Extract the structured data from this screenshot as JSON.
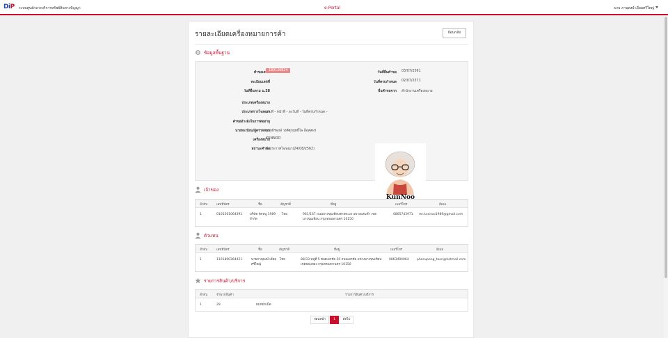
{
  "header": {
    "logo_main": "Di",
    "logo_accent": "P",
    "org_name": "ระบบศูนย์กลางบริการทรัพย์สินทางปัญญา",
    "portal_name": "e-Portal",
    "user_name": "นาย ภานุพงษ์ เอี่ยมศรีใหญ่"
  },
  "page": {
    "title": "รายละเอียดเครื่องหมายการค้า",
    "back_label": "ย้อนกลับ"
  },
  "basic_info": {
    "section_title": "ข้อมูลพื้นฐาน",
    "left_fields": [
      {
        "label": "คำขอเลขที่",
        "value": "180120824"
      },
      {
        "label": "ทะเบียนเลขที่",
        "value": "-"
      },
      {
        "label": "วันที่ยื่นตาม ม.28",
        "value": "-"
      },
      {
        "label": "ประเภทเครื่องหมาย",
        "value": "-"
      },
      {
        "label": "ประเภทการโฆษณา",
        "value": "เล่มที่ - หน้าที่ - ลงวันที่ - วันที่ครบกำหนด -"
      },
      {
        "label": "คำขออ้างอิงในการต่ออายุ",
        "value": "-"
      },
      {
        "label": "นายทะเบียน/ผู้ตรวจสอบ",
        "value": "นายธีรพงษ์ วงศ์ศุภฤทธิ์ไพ อ็อสสพร"
      },
      {
        "label": "เครื่องหมาย",
        "value": "KUNNOO"
      },
      {
        "label": "สถานะคำขอ",
        "value": "สั่งประกาศโฆษณา(24/08/2562)"
      }
    ],
    "right_fields": [
      {
        "label": "วันที่ยื่นคำขอ",
        "value": "03/07/2561"
      },
      {
        "label": "วันที่ครบกำหนด",
        "value": "02/07/2571"
      },
      {
        "label": "ยื่นคำขอจาก",
        "value": "สำนักงานเครื่องหมาย"
      }
    ],
    "mark_text": "KunNoo",
    "colors": {
      "badge": "#e98a8a",
      "accent": "#c8102e"
    }
  },
  "owner": {
    "section_title": "เจ้าของ",
    "headers": [
      "ลำดับ",
      "เลขที่บัตร",
      "ชื่อ",
      "สัญชาติ",
      "ที่อยู่",
      "เบอร์โทร",
      "อีเมล"
    ],
    "rows": [
      [
        "1",
        "0105561064391",
        "บริษัท จัดหนู 1989 จำกัด",
        "ไทย",
        "961/167 ถนนบางขุนเทียนชายทะเล แขวงแสมดำ เขตบางขุนเทียน กรุงเทพมหานคร 10150",
        "0865743971",
        "mr.kunnoo1989@gmail.com"
      ]
    ]
  },
  "agent": {
    "section_title": "ตัวแทน",
    "headers": [
      "ลำดับ",
      "เลขที่บัตร",
      "ชื่อ",
      "สัญชาติ",
      "ที่อยู่",
      "เบอร์โทร",
      "อีเมล"
    ],
    "rows": [
      [
        "1",
        "1101800364421",
        "นายภานุพงษ์ เอี่ยมศรีใหญ่",
        "ไทย",
        "88/33 หมู่ที่ 5 ซอยเอกชัย 30 ถนนเอกชัย แขวงบางขุนเทียน เขตจอมทอง กรุงเทพมหานคร 10150",
        "0863494064",
        "phanupong_toon@hotmail.com"
      ]
    ]
  },
  "services": {
    "section_title": "รายการสินค้า/บริการ",
    "headers": [
      "ลำดับ",
      "จำพวกสินค้า",
      "รายการสินค้า/บริการ"
    ],
    "rows": [
      [
        "1",
        "29",
        "ผมหมักเม็ด"
      ]
    ]
  },
  "pagination": {
    "prev": "ก่อนหน้า",
    "current": "1",
    "next": "ถัดไป"
  }
}
